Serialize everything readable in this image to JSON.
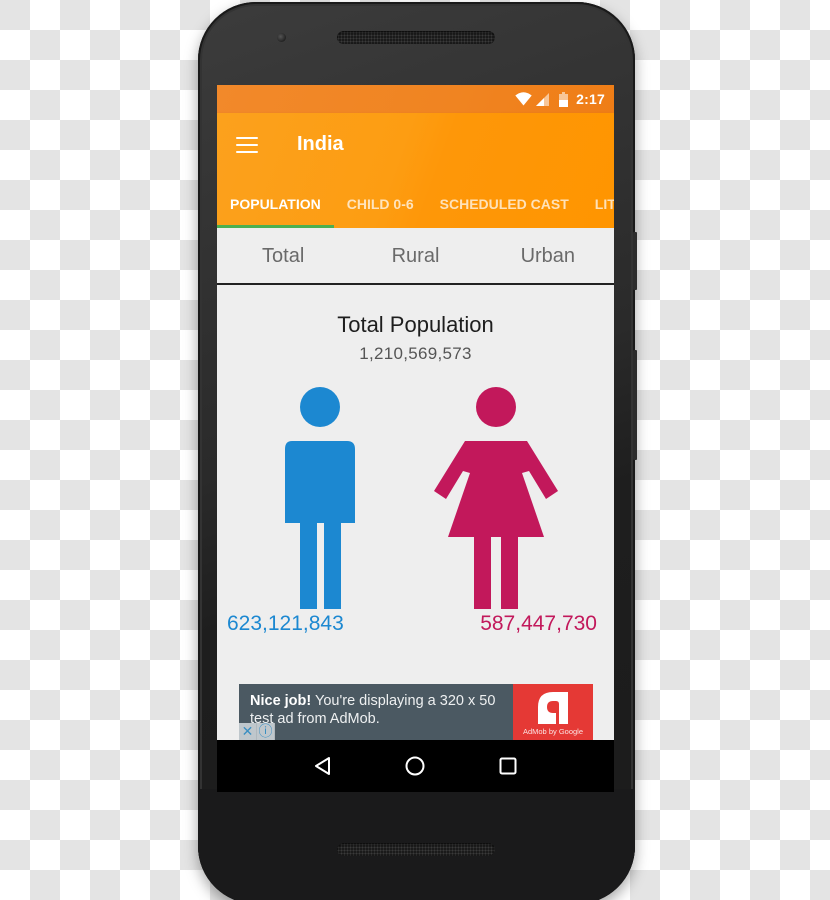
{
  "status_bar": {
    "time": "2:17",
    "icons": [
      "wifi-icon",
      "cell-signal-icon",
      "battery-icon"
    ]
  },
  "app_bar": {
    "title": "India",
    "menu_icon": "hamburger-menu-icon"
  },
  "tabs": [
    {
      "label": "POPULATION",
      "active": true
    },
    {
      "label": "CHILD 0-6",
      "active": false
    },
    {
      "label": "SCHEDULED CAST",
      "active": false
    },
    {
      "label": "LITERACY",
      "active": false
    }
  ],
  "sub_tabs": [
    {
      "label": "Total"
    },
    {
      "label": "Rural"
    },
    {
      "label": "Urban"
    }
  ],
  "summary": {
    "title": "Total Population",
    "total": "1,210,569,573",
    "male": {
      "count": "623,121,843",
      "color": "#1c88d1",
      "icon": "male-figure-icon"
    },
    "female": {
      "count": "587,447,730",
      "color": "#c2185b",
      "icon": "female-figure-icon"
    }
  },
  "ad": {
    "bold": "Nice job!",
    "text": " You're displaying a 320 x 50 test ad from AdMob.",
    "brand_caption": "AdMob by Google",
    "brand_color": "#e53935",
    "close_glyph": "✕",
    "info_glyph": "ⓘ"
  },
  "nav_bar": {
    "buttons": [
      "back-icon",
      "home-icon",
      "recents-icon"
    ]
  },
  "colors": {
    "status_bar": "#f08421",
    "app_bar": "#ff9800",
    "tab_indicator": "#4caf50",
    "screen_bg": "#eeeeee"
  }
}
